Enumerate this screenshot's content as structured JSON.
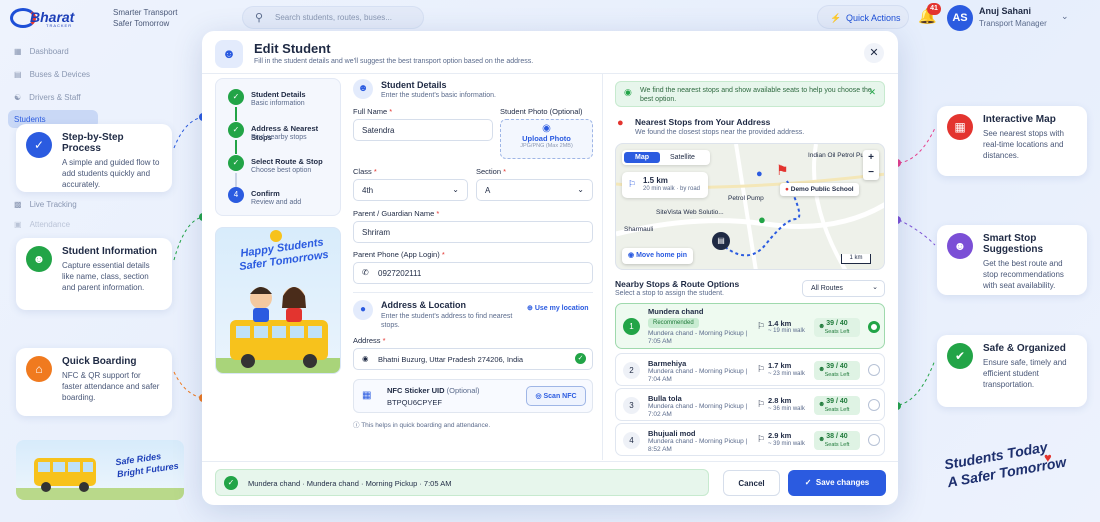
{
  "brand": {
    "name": "Bharat",
    "sub": "TRACKER",
    "tagline_1": "Smarter Transport",
    "tagline_2": "Safer Tomorrow"
  },
  "search": {
    "placeholder": "Search students, routes, buses..."
  },
  "header": {
    "quick_actions": "Quick Actions",
    "notifications": "41",
    "avatar_initials": "AS",
    "user_name": "Anuj Sahani",
    "user_role": "Transport Manager"
  },
  "sidebar": {
    "items": [
      "Dashboard",
      "Buses & Devices",
      "Drivers & Staff",
      "Students",
      "Live Tracking",
      "Attendance"
    ]
  },
  "features_left": [
    {
      "title": "Step-by-Step Process",
      "desc": "A simple and guided flow to add students quickly and accurately."
    },
    {
      "title": "Student Information",
      "desc": "Capture essential details like name, class, section and parent information."
    },
    {
      "title": "Quick Boarding",
      "desc": "NFC & QR support for faster attendance and safer boarding."
    }
  ],
  "features_right": [
    {
      "title": "Interactive Map",
      "desc": "See nearest stops with real-time locations and distances."
    },
    {
      "title": "Smart Stop Suggestions",
      "desc": "Get the best route and stop recommendations with seat availability."
    },
    {
      "title": "Safe & Organized",
      "desc": "Ensure safe, timely and efficient student transportation."
    }
  ],
  "bottom_left_banner": {
    "line1": "Safe Rides",
    "line2": "Bright Futures"
  },
  "bottom_right_slogan": {
    "line1": "Students Today",
    "line2": "A Safer Tomorrow"
  },
  "modal": {
    "title": "Edit Student",
    "subtitle": "Fill in the student details and we'll suggest the best transport option based on the address.",
    "steps": [
      {
        "title": "Student Details",
        "sub": "Basic information"
      },
      {
        "title": "Address & Nearest Stops",
        "sub": "Find nearby stops"
      },
      {
        "title": "Select Route & Stop",
        "sub": "Choose best option"
      },
      {
        "num": "4",
        "title": "Confirm",
        "sub": "Review and add"
      }
    ],
    "promo": {
      "line1": "Happy Students",
      "line2": "Safer Tomorrows"
    },
    "details": {
      "title": "Student Details",
      "sub": "Enter the student's basic information.",
      "full_name_label": "Full Name",
      "full_name": "Satendra",
      "photo_label": "Student Photo (Optional)",
      "upload": "Upload Photo",
      "upload_hint": "JPG/PNG (Max 2MB)",
      "class_label": "Class",
      "class": "4th",
      "section_label": "Section",
      "section": "A",
      "guardian_label": "Parent / Guardian Name",
      "guardian": "Shriram",
      "phone_label": "Parent Phone (App Login)",
      "phone": "0927202111"
    },
    "address": {
      "title": "Address & Location",
      "sub": "Enter the student's address to find nearest stops.",
      "use_location": "Use my location",
      "address_label": "Address",
      "address": "Bhatni Buzurg, Uttar Pradesh 274206, India",
      "nfc_label": "NFC Sticker UID",
      "nfc_optional": "(Optional)",
      "nfc": "BTPQU6CPYEF",
      "scan": "Scan NFC",
      "hint": "This helps in quick boarding and attendance."
    },
    "info_bar": "We find the nearest stops and show available seats to help you choose the best option.",
    "nearest": {
      "title": "Nearest Stops from Your Address",
      "sub": "We found the closest stops near the provided address."
    },
    "map": {
      "tab_map": "Map",
      "tab_sat": "Satellite",
      "walk_km": "1.5 km",
      "walk_desc": "20 min walk · by road",
      "labels": [
        "Indian Oil Petrol Pump",
        "Petrol Pump",
        "Demo Public School",
        "SiteVista Web Solutio...",
        "Sharmauli"
      ],
      "move_pin": "Move home pin",
      "scale": "1 km",
      "zoom_in": "+",
      "zoom_out": "−"
    },
    "options": {
      "title": "Nearby Stops & Route Options",
      "sub": "Select a stop to assign the student.",
      "filter": "All Routes"
    },
    "stops": [
      {
        "num": "1",
        "name": "Mundera chand",
        "badge": "Recommended",
        "route": "Mundera chand - Morning Pickup | 7:05 AM",
        "km": "1.4 km",
        "walk": "~ 19 min walk",
        "seats": "39 / 40",
        "seats_sub": "Seats Left"
      },
      {
        "num": "2",
        "name": "Barmehiya",
        "route": "Mundera chand - Morning Pickup | 7:04 AM",
        "km": "1.7 km",
        "walk": "~ 23 min walk",
        "seats": "39 / 40",
        "seats_sub": "Seats Left"
      },
      {
        "num": "3",
        "name": "Bulla tola",
        "route": "Mundera chand - Morning Pickup | 7:02 AM",
        "km": "2.8 km",
        "walk": "~ 36 min walk",
        "seats": "39 / 40",
        "seats_sub": "Seats Left"
      },
      {
        "num": "4",
        "name": "Bhujuali mod",
        "route": "Mundera chand - Morning Pickup | 8:52 AM",
        "km": "2.9 km",
        "walk": "~ 39 min walk",
        "seats": "38 / 40",
        "seats_sub": "Seats Left"
      }
    ],
    "footer": {
      "selection": "Mundera chand · Mundera chand · Morning Pickup · 7:05 AM",
      "cancel": "Cancel",
      "save": "Save changes"
    }
  },
  "colors": {
    "primary": "#2b5be0",
    "success": "#22a447",
    "danger": "#e3342f",
    "orange": "#f07a1f",
    "purple": "#7b4fd6"
  }
}
